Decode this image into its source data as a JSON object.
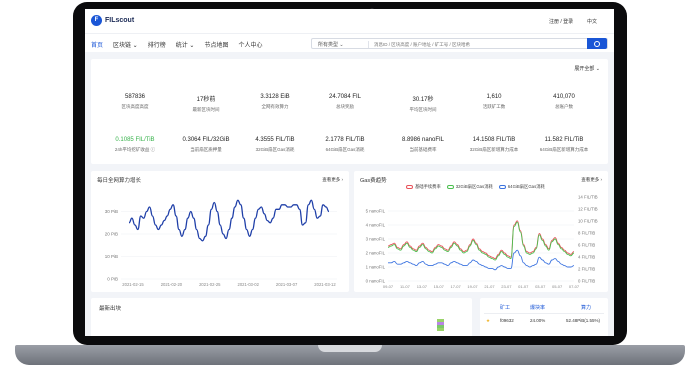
{
  "brand": {
    "name": "FILscout",
    "mark": "F"
  },
  "header": {
    "login": "注册 / 登录",
    "lang": "中文"
  },
  "nav": [
    {
      "label": "首页",
      "active": true
    },
    {
      "label": "区块链 ⌄",
      "active": false
    },
    {
      "label": "排行榜",
      "active": false
    },
    {
      "label": "统计 ⌄",
      "active": false
    },
    {
      "label": "节点地图",
      "active": false
    },
    {
      "label": "个人中心",
      "active": false
    }
  ],
  "search": {
    "type": "所有类型 ⌄",
    "placeholder": "消息ID / 区块高度 / 账户地址 / 矿工号 / 区块哈希"
  },
  "overview": {
    "expand": "展开全部 ⌄",
    "row1": [
      {
        "value": "587836",
        "label": "区块高度高度"
      },
      {
        "value": "17秒前",
        "label": "最新区块时间"
      },
      {
        "value": "3.3128 EiB",
        "label": "全网有效算力"
      },
      {
        "value": "24.7084 FIL",
        "label": "总块奖励"
      },
      {
        "value": "30.17秒",
        "label": "平均区块时间"
      },
      {
        "value": "1,610",
        "label": "活跃矿工数"
      },
      {
        "value": "410,070",
        "label": "总账户数"
      }
    ],
    "row2": [
      {
        "value": "0.1085 FIL/TiB",
        "label": "24h平均挖矿收益 ⓘ",
        "green": true
      },
      {
        "value": "0.3064 FIL/32GiB",
        "label": "当前扇区质押量"
      },
      {
        "value": "4.3555 FIL/TiB",
        "label": "32GiB扇区Gas消耗"
      },
      {
        "value": "2.1778 FIL/TiB",
        "label": "64GiB扇区Gas消耗"
      },
      {
        "value": "8.8986 nanoFIL",
        "label": "当前基础费率"
      },
      {
        "value": "14.1508 FIL/TiB",
        "label": "32GiB扇区新增算力成本"
      },
      {
        "value": "11.582 FIL/TiB",
        "label": "64GiB扇区新增算力成本"
      }
    ]
  },
  "chart_data": [
    {
      "type": "line",
      "title": "每日全网算力增长",
      "more": "查看更多 ›",
      "ylabel": "",
      "ylim": [
        0,
        40
      ],
      "y_ticks": [
        "0 PiB",
        "10 PiB",
        "20 PiB",
        "30 PiB"
      ],
      "x_ticks": [
        "2021-02-15",
        "2021-02-20",
        "2021-02-25",
        "2021-03-02",
        "2021-03-07",
        "2021-03-12"
      ],
      "series": [
        {
          "values": [
            25,
            27,
            24,
            22,
            28,
            27,
            30,
            32,
            28,
            24,
            22,
            24,
            26,
            28,
            31,
            33,
            28,
            22,
            19,
            22,
            27,
            30,
            27,
            22,
            18,
            17,
            19,
            24,
            31,
            34,
            30,
            24,
            20,
            18,
            22,
            27,
            32,
            35,
            33,
            27,
            22,
            19,
            22,
            27,
            31,
            32,
            29,
            26,
            25,
            27,
            31,
            31,
            33,
            33,
            32,
            32,
            33,
            33,
            31,
            24,
            25,
            33,
            35,
            31,
            27,
            28,
            33,
            32,
            30
          ]
        }
      ]
    },
    {
      "type": "line",
      "title": "Gas费趋势",
      "more": "查看更多 ›",
      "ylim_left": [
        0,
        6
      ],
      "y_ticks_left": [
        "0 nanoFIL",
        "1 nanoFIL",
        "2 nanoFIL",
        "3 nanoFIL",
        "4 nanoFIL",
        "5 nanoFIL"
      ],
      "ylim_right": [
        0,
        14
      ],
      "y_ticks_right": [
        "0 FIL/TiB",
        "2 FIL/TiB",
        "4 FIL/TiB",
        "6 FIL/TiB",
        "8 FIL/TiB",
        "10 FIL/TiB",
        "12 FIL/TiB",
        "14 FIL/TiB"
      ],
      "x_ticks": [
        "09-07",
        "11-07",
        "13-07",
        "15-07",
        "17-07",
        "19-07",
        "21-07",
        "23-07",
        "01-07",
        "03-07",
        "05-07",
        "07-07"
      ],
      "series": [
        {
          "name": "基础手续费率",
          "color": "#e8525a",
          "values": [
            2.5,
            2.6,
            2.7,
            2.4,
            2.3,
            2.6,
            2.8,
            2.5,
            2.3,
            2.2,
            2.5,
            2.7,
            2.4,
            2.2,
            2.1,
            2.4,
            2.6,
            2.5,
            2.3,
            2.2,
            2.5,
            2.8,
            2.6,
            2.3,
            2.1,
            2.2,
            2.6,
            3.0,
            2.7,
            2.3,
            2.1,
            2.0,
            1.8,
            1.7,
            1.6,
            1.9,
            2.2,
            2.0,
            1.8,
            1.7,
            4.0,
            4.3,
            3.6,
            2.6,
            2.1,
            2.0,
            2.1,
            2.4,
            3.4,
            3.0,
            2.6,
            2.3,
            2.9,
            3.1,
            2.7,
            2.4,
            2.2,
            2.0,
            1.9,
            2.1
          ]
        },
        {
          "name": "32GiB扇区Gas消耗",
          "color": "#4cc04f",
          "values": [
            2.4,
            2.5,
            2.6,
            2.3,
            2.2,
            2.5,
            2.7,
            2.4,
            2.2,
            2.1,
            2.4,
            2.6,
            2.3,
            2.1,
            2.0,
            2.3,
            2.5,
            2.4,
            2.2,
            2.1,
            2.4,
            2.7,
            2.5,
            2.2,
            2.0,
            2.1,
            2.5,
            2.9,
            2.6,
            2.2,
            2.0,
            1.9,
            1.7,
            1.6,
            1.5,
            1.8,
            2.1,
            1.9,
            1.7,
            1.6,
            3.9,
            4.2,
            3.5,
            2.5,
            2.0,
            1.9,
            2.0,
            2.3,
            3.3,
            2.9,
            2.5,
            2.2,
            2.8,
            3.0,
            2.6,
            2.3,
            2.1,
            1.9,
            1.8,
            2.0
          ]
        },
        {
          "name": "64GiB扇区Gas消耗",
          "color": "#3b73e0",
          "values": [
            1.3,
            1.3,
            1.4,
            1.2,
            1.2,
            1.3,
            1.4,
            1.3,
            1.2,
            1.1,
            1.3,
            1.4,
            1.2,
            1.1,
            1.1,
            1.2,
            1.3,
            1.3,
            1.2,
            1.1,
            1.3,
            1.4,
            1.3,
            1.2,
            1.1,
            1.1,
            1.3,
            1.5,
            1.4,
            1.2,
            1.1,
            1.0,
            0.9,
            0.9,
            0.8,
            1.0,
            1.1,
            1.0,
            0.9,
            0.9,
            2.0,
            2.2,
            1.8,
            1.3,
            1.1,
            1.0,
            1.1,
            1.2,
            1.7,
            1.5,
            1.3,
            1.2,
            1.5,
            1.6,
            1.4,
            1.2,
            1.1,
            1.0,
            1.0,
            1.1
          ]
        }
      ]
    }
  ],
  "latest_blocks": {
    "title": "最新出块"
  },
  "miner_table": {
    "headers": [
      "矿工",
      "爆块率",
      "算力"
    ],
    "rows": [
      {
        "rank": "★",
        "miner": "f09632",
        "rate": "24.00%",
        "power": "52.48PiB(1.55%)"
      }
    ]
  }
}
